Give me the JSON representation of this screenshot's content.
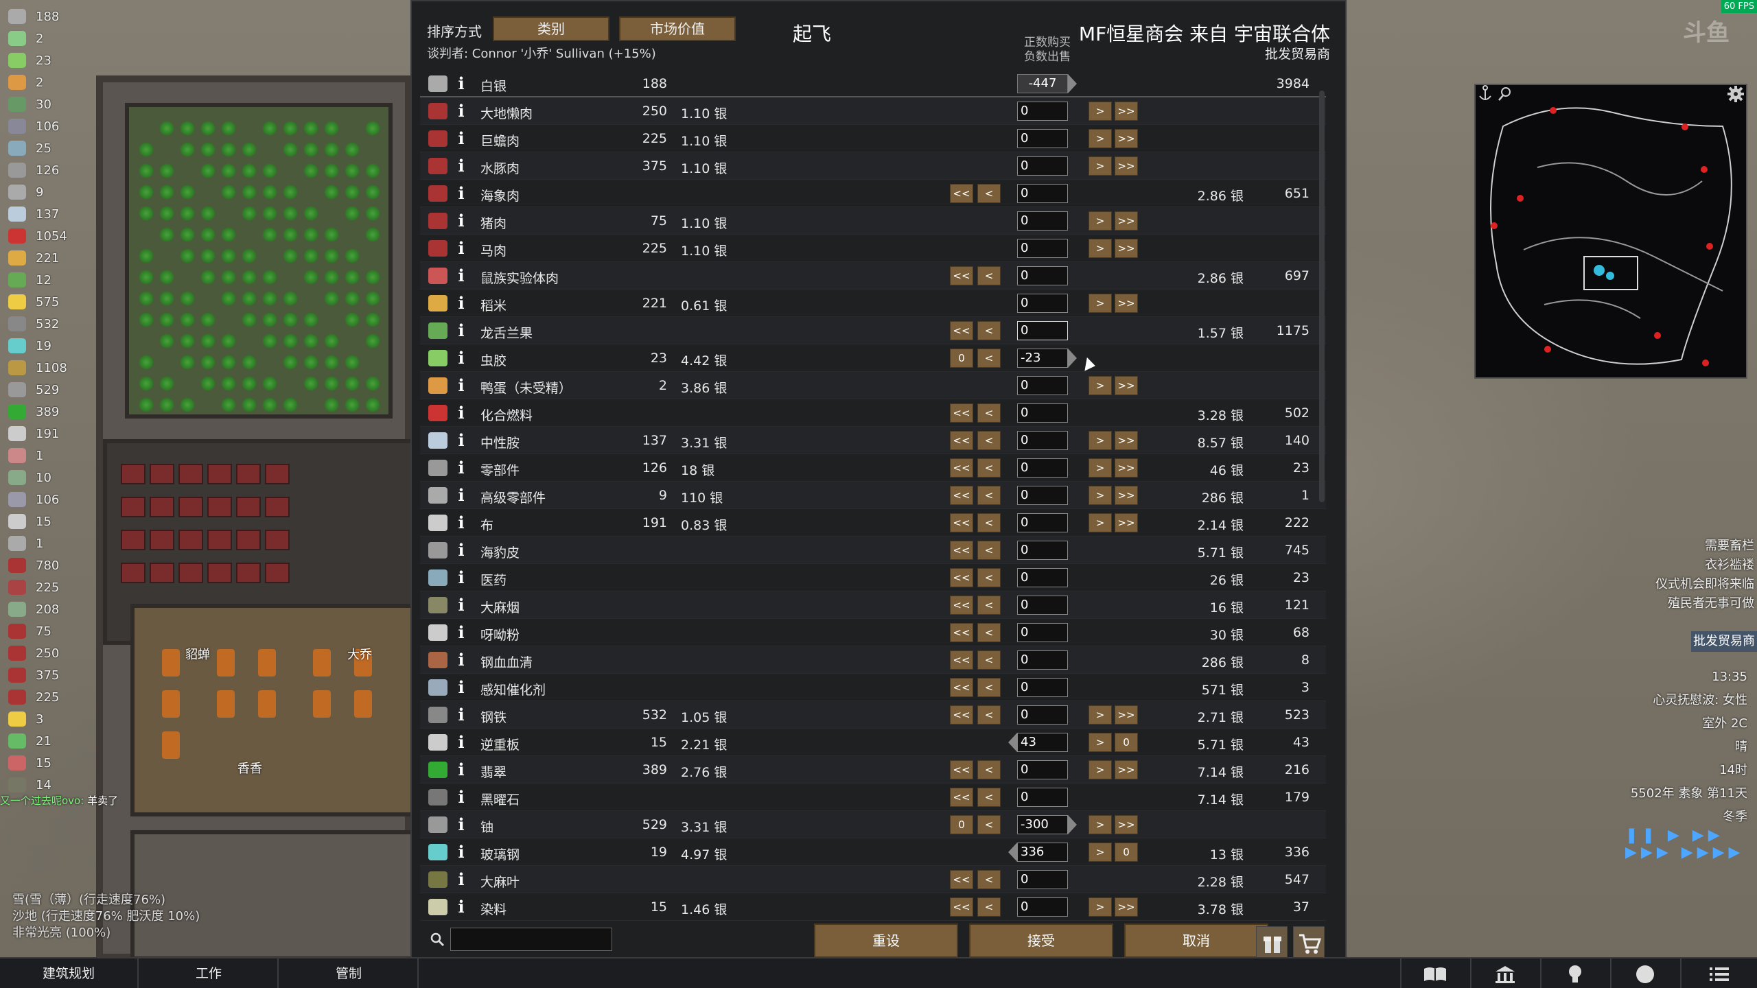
{
  "resources": [
    {
      "value": "188",
      "color": "#aaa"
    },
    {
      "value": "2",
      "color": "#8c8"
    },
    {
      "value": "23",
      "color": "#8c6"
    },
    {
      "value": "2",
      "color": "#d94"
    },
    {
      "value": "30",
      "color": "#696"
    },
    {
      "value": "106",
      "color": "#889"
    },
    {
      "value": "25",
      "color": "#8ab"
    },
    {
      "value": "126",
      "color": "#999"
    },
    {
      "value": "9",
      "color": "#aaa"
    },
    {
      "value": "137",
      "color": "#bcd"
    },
    {
      "value": "1054",
      "color": "#c33"
    },
    {
      "value": "221",
      "color": "#da4"
    },
    {
      "value": "12",
      "color": "#6a5"
    },
    {
      "value": "575",
      "color": "#ec4"
    },
    {
      "value": "532",
      "color": "#888"
    },
    {
      "value": "19",
      "color": "#6cc"
    },
    {
      "value": "1108",
      "color": "#b94"
    },
    {
      "value": "529",
      "color": "#999"
    },
    {
      "value": "389",
      "color": "#3a3"
    },
    {
      "value": "191",
      "color": "#ccc"
    },
    {
      "value": "1",
      "color": "#c88"
    },
    {
      "value": "10",
      "color": "#8a8"
    },
    {
      "value": "106",
      "color": "#99a"
    },
    {
      "value": "15",
      "color": "#ccc"
    },
    {
      "value": "1",
      "color": "#aaa"
    },
    {
      "value": "780",
      "color": "#a33"
    },
    {
      "value": "225",
      "color": "#a44"
    },
    {
      "value": "208",
      "color": "#8a8"
    },
    {
      "value": "75",
      "color": "#a33"
    },
    {
      "value": "250",
      "color": "#a33"
    },
    {
      "value": "375",
      "color": "#a33"
    },
    {
      "value": "225",
      "color": "#a33"
    },
    {
      "value": "3",
      "color": "#ec4"
    },
    {
      "value": "21",
      "color": "#6b6"
    },
    {
      "value": "15",
      "color": "#c66"
    },
    {
      "value": "14",
      "color": "#776"
    }
  ],
  "trade": {
    "sort_label": "排序方式",
    "sort_btn_1": "类别",
    "sort_btn_2": "市场价值",
    "title": "起飞",
    "negotiator": "谈判者: Connor '小乔' Sullivan (+15%)",
    "buy_hint_1": "正数购买",
    "buy_hint_2": "负数出售",
    "trader_name": "MF恒星商会 来自 宇宙联合体",
    "trader_type": "批发贸易商",
    "rows": [
      {
        "name": "白银",
        "qty": "188",
        "price": "",
        "value": "-447",
        "tprice": "",
        "tqty": "3984",
        "icon": "#aaa",
        "ll": "",
        "l": "",
        "r": "",
        "rr": "",
        "mode": "silver"
      },
      {
        "name": "大地懒肉",
        "qty": "250",
        "price": "1.10 银",
        "value": "0",
        "tprice": "",
        "tqty": "",
        "icon": "#a33",
        "ll": "",
        "l": "",
        "r": ">",
        "rr": ">>"
      },
      {
        "name": "巨蟾肉",
        "qty": "225",
        "price": "1.10 银",
        "value": "0",
        "tprice": "",
        "tqty": "",
        "icon": "#a33",
        "ll": "",
        "l": "",
        "r": ">",
        "rr": ">>"
      },
      {
        "name": "水豚肉",
        "qty": "375",
        "price": "1.10 银",
        "value": "0",
        "tprice": "",
        "tqty": "",
        "icon": "#a33",
        "ll": "",
        "l": "",
        "r": ">",
        "rr": ">>"
      },
      {
        "name": "海象肉",
        "qty": "",
        "price": "",
        "value": "0",
        "tprice": "2.86 银",
        "tqty": "651",
        "icon": "#a33",
        "ll": "<<",
        "l": "<",
        "r": "",
        "rr": ""
      },
      {
        "name": "猪肉",
        "qty": "75",
        "price": "1.10 银",
        "value": "0",
        "tprice": "",
        "tqty": "",
        "icon": "#a33",
        "ll": "",
        "l": "",
        "r": ">",
        "rr": ">>"
      },
      {
        "name": "马肉",
        "qty": "225",
        "price": "1.10 银",
        "value": "0",
        "tprice": "",
        "tqty": "",
        "icon": "#a33",
        "ll": "",
        "l": "",
        "r": ">",
        "rr": ">>"
      },
      {
        "name": "鼠族实验体肉",
        "qty": "",
        "price": "",
        "value": "0",
        "tprice": "2.86 银",
        "tqty": "697",
        "icon": "#c55",
        "ll": "<<",
        "l": "<",
        "r": "",
        "rr": ""
      },
      {
        "name": "稻米",
        "qty": "221",
        "price": "0.61 银",
        "value": "0",
        "tprice": "",
        "tqty": "",
        "icon": "#da4",
        "ll": "",
        "l": "",
        "r": ">",
        "rr": ">>"
      },
      {
        "name": "龙舌兰果",
        "qty": "",
        "price": "",
        "value": "0",
        "tprice": "1.57 银",
        "tqty": "1175",
        "icon": "#6a5",
        "ll": "<<",
        "l": "<",
        "r": "",
        "rr": "",
        "active": true
      },
      {
        "name": "虫胶",
        "qty": "23",
        "price": "4.42 银",
        "value": "-23",
        "tprice": "",
        "tqty": "",
        "icon": "#8c6",
        "ll": "0",
        "l": "<",
        "r": "",
        "rr": "",
        "mode": "sell"
      },
      {
        "name": "鸭蛋（未受精）",
        "qty": "2",
        "price": "3.86 银",
        "value": "0",
        "tprice": "",
        "tqty": "",
        "icon": "#d94",
        "ll": "",
        "l": "",
        "r": ">",
        "rr": ">>"
      },
      {
        "name": "化合燃料",
        "qty": "",
        "price": "",
        "value": "0",
        "tprice": "3.28 银",
        "tqty": "502",
        "icon": "#c33",
        "ll": "<<",
        "l": "<",
        "r": "",
        "rr": ""
      },
      {
        "name": "中性胺",
        "qty": "137",
        "price": "3.31 银",
        "value": "0",
        "tprice": "8.57 银",
        "tqty": "140",
        "icon": "#bcd",
        "ll": "<<",
        "l": "<",
        "r": ">",
        "rr": ">>"
      },
      {
        "name": "零部件",
        "qty": "126",
        "price": "18 银",
        "value": "0",
        "tprice": "46 银",
        "tqty": "23",
        "icon": "#999",
        "ll": "<<",
        "l": "<",
        "r": ">",
        "rr": ">>"
      },
      {
        "name": "高级零部件",
        "qty": "9",
        "price": "110 银",
        "value": "0",
        "tprice": "286 银",
        "tqty": "1",
        "icon": "#aaa",
        "ll": "<<",
        "l": "<",
        "r": ">",
        "rr": ">>"
      },
      {
        "name": "布",
        "qty": "191",
        "price": "0.83 银",
        "value": "0",
        "tprice": "2.14 银",
        "tqty": "222",
        "icon": "#ccc",
        "ll": "<<",
        "l": "<",
        "r": ">",
        "rr": ">>"
      },
      {
        "name": "海豹皮",
        "qty": "",
        "price": "",
        "value": "0",
        "tprice": "5.71 银",
        "tqty": "745",
        "icon": "#999",
        "ll": "<<",
        "l": "<",
        "r": "",
        "rr": ""
      },
      {
        "name": "医药",
        "qty": "",
        "price": "",
        "value": "0",
        "tprice": "26 银",
        "tqty": "23",
        "icon": "#8ab",
        "ll": "<<",
        "l": "<",
        "r": "",
        "rr": ""
      },
      {
        "name": "大麻烟",
        "qty": "",
        "price": "",
        "value": "0",
        "tprice": "16 银",
        "tqty": "121",
        "icon": "#886",
        "ll": "<<",
        "l": "<",
        "r": "",
        "rr": ""
      },
      {
        "name": "呀呦粉",
        "qty": "",
        "price": "",
        "value": "0",
        "tprice": "30 银",
        "tqty": "68",
        "icon": "#ccc",
        "ll": "<<",
        "l": "<",
        "r": "",
        "rr": ""
      },
      {
        "name": "钢血血清",
        "qty": "",
        "price": "",
        "value": "0",
        "tprice": "286 银",
        "tqty": "8",
        "icon": "#a64",
        "ll": "<<",
        "l": "<",
        "r": "",
        "rr": ""
      },
      {
        "name": "感知催化剂",
        "qty": "",
        "price": "",
        "value": "0",
        "tprice": "571 银",
        "tqty": "3",
        "icon": "#9ab",
        "ll": "<<",
        "l": "<",
        "r": "",
        "rr": ""
      },
      {
        "name": "钢铁",
        "qty": "532",
        "price": "1.05 银",
        "value": "0",
        "tprice": "2.71 银",
        "tqty": "523",
        "icon": "#888",
        "ll": "<<",
        "l": "<",
        "r": ">",
        "rr": ">>"
      },
      {
        "name": "逆重板",
        "qty": "15",
        "price": "2.21 银",
        "value": "43",
        "tprice": "5.71 银",
        "tqty": "43",
        "icon": "#ccc",
        "ll": "",
        "l": "",
        "r": ">",
        "rr": "0",
        "mode": "buy"
      },
      {
        "name": "翡翠",
        "qty": "389",
        "price": "2.76 银",
        "value": "0",
        "tprice": "7.14 银",
        "tqty": "216",
        "icon": "#3a3",
        "ll": "<<",
        "l": "<",
        "r": ">",
        "rr": ">>"
      },
      {
        "name": "黑曜石",
        "qty": "",
        "price": "",
        "value": "0",
        "tprice": "7.14 银",
        "tqty": "179",
        "icon": "#777",
        "ll": "<<",
        "l": "<",
        "r": "",
        "rr": ""
      },
      {
        "name": "铀",
        "qty": "529",
        "price": "3.31 银",
        "value": "-300",
        "tprice": "",
        "tqty": "",
        "icon": "#999",
        "ll": "0",
        "l": "<",
        "r": ">",
        "rr": ">>",
        "mode": "sell"
      },
      {
        "name": "玻璃钢",
        "qty": "19",
        "price": "4.97 银",
        "value": "336",
        "tprice": "13 银",
        "tqty": "336",
        "icon": "#6cc",
        "ll": "",
        "l": "",
        "r": ">",
        "rr": "0",
        "mode": "buy"
      },
      {
        "name": "大麻叶",
        "qty": "",
        "price": "",
        "value": "0",
        "tprice": "2.28 银",
        "tqty": "547",
        "icon": "#774",
        "ll": "<<",
        "l": "<",
        "r": "",
        "rr": ""
      },
      {
        "name": "染料",
        "qty": "15",
        "price": "1.46 银",
        "value": "0",
        "tprice": "3.78 银",
        "tqty": "37",
        "icon": "#cca",
        "ll": "<<",
        "l": "<",
        "r": ">",
        "rr": ">>"
      }
    ],
    "search_placeholder": "",
    "reset_label": "重设",
    "accept_label": "接受",
    "cancel_label": "取消"
  },
  "pawns": [
    "貂蝉",
    "大乔",
    "香香"
  ],
  "chat": {
    "who": "又一个过去呢ovo:",
    "msg": "羊卖了"
  },
  "terrain": [
    "雪(雪（薄）(行走速度76%)",
    "沙地 (行走速度76% 肥沃度 10%)",
    "非常光亮 (100%)"
  ],
  "alerts": [
    "需要畜栏",
    "衣衫褴褛",
    "仪式机会即将来临",
    "殖民者无事可做"
  ],
  "alert_trade": "批发贸易商",
  "clock": [
    "13:35",
    "心灵抚慰波: 女性",
    "室外 2C",
    "晴",
    "14时",
    "5502年 素象 第11天",
    "冬季"
  ],
  "speed": "❚❚ ▶ ▶▶ ▶▶▶ ▶▶▶▶",
  "fps": "60 FPS",
  "watermark": "斗鱼",
  "tabs": [
    "建筑规划",
    "工作",
    "管制"
  ]
}
